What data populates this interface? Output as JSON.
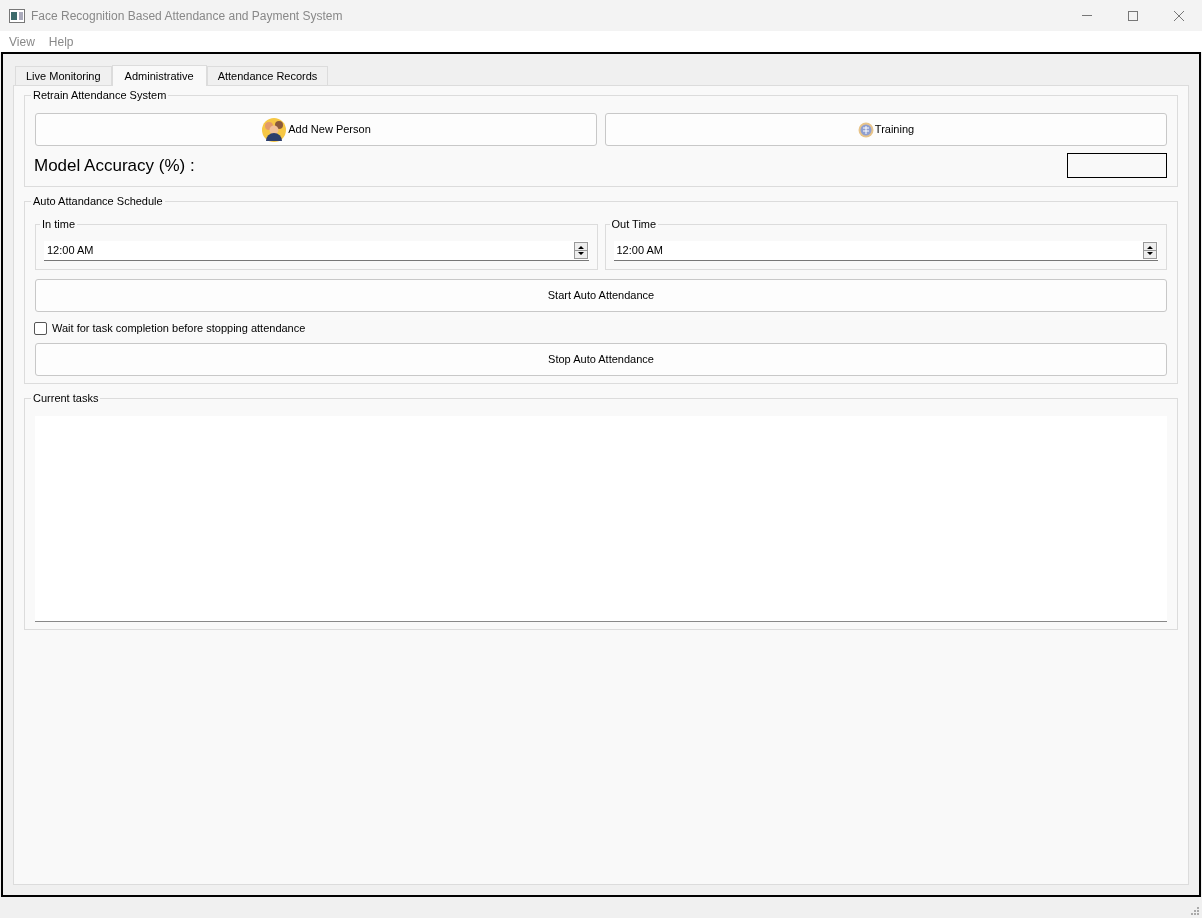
{
  "window": {
    "title": "Face Recognition Based Attendance and Payment System"
  },
  "menu": [
    "View",
    "Help"
  ],
  "tabs": [
    {
      "label": "Live Monitoring",
      "selected": false
    },
    {
      "label": "Administrative",
      "selected": true
    },
    {
      "label": "Attendance Records",
      "selected": false
    }
  ],
  "retrain": {
    "title": "Retrain Attendance System",
    "add_button": "Add New Person",
    "train_button": "Training",
    "accuracy_label": "Model Accuracy (%) :"
  },
  "schedule": {
    "title": "Auto Attandance Schedule",
    "times": [
      {
        "label": "In time",
        "value": "12:00 AM"
      },
      {
        "label": "Out Time",
        "value": "12:00 AM"
      }
    ],
    "start_button": "Start Auto Attendance",
    "wait_checkbox": {
      "label": "Wait for task completion before stopping attendance",
      "checked": false
    },
    "stop_button": "Stop Auto Attendance"
  },
  "tasks": {
    "title": "Current tasks"
  }
}
